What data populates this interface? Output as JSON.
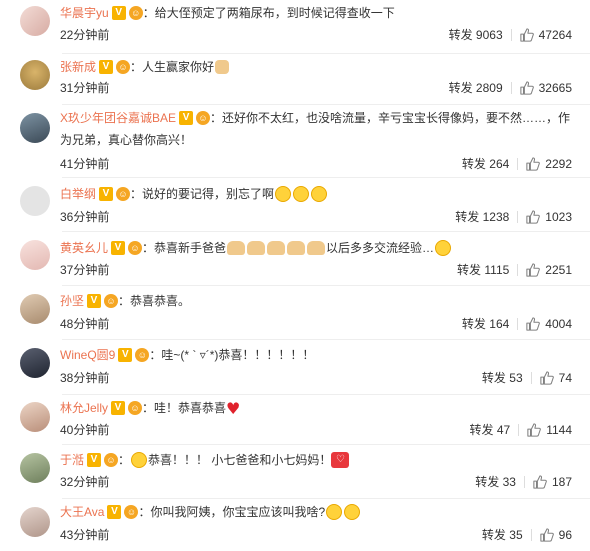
{
  "colors": {
    "username": "#eb7350",
    "text": "#333333",
    "badge_v": "#f8b300",
    "divider": "#eeeeee"
  },
  "labels": {
    "repost": "转发",
    "colon": "："
  },
  "comments": [
    {
      "username": "华晨宇yu",
      "avatar_color": "#e8c5bf",
      "text": "给大侄预定了两箱尿布，到时候记得查收一下",
      "emojis": [],
      "time": "22分钟前",
      "reposts": "9063",
      "likes": "47264"
    },
    {
      "username": "张新成",
      "avatar_color": "#c7a25c",
      "text": "人生赢家你好",
      "emojis": [
        "thumbs-up-emoji"
      ],
      "time": "31分钟前",
      "reposts": "2809",
      "likes": "32665"
    },
    {
      "username": "X玖少年团谷嘉诚BAE",
      "avatar_color": "#5f7586",
      "text": "还好你不太红，也没啥流量，辛亏宝宝长得像妈，要不然……，作为兄弟，真心替你高兴！",
      "emojis": [],
      "time": "41分钟前",
      "reposts": "264",
      "likes": "2292"
    },
    {
      "username": "白举纲",
      "avatar_color": "#dddddd",
      "text": "说好的要记得，别忘了啊",
      "emojis": [
        "smile-emoji",
        "smile-emoji",
        "smile-emoji"
      ],
      "time": "36分钟前",
      "reposts": "1238",
      "likes": "1023"
    },
    {
      "username": "黄英幺儿",
      "avatar_color": "#f2d5d2",
      "text": "恭喜新手爸爸",
      "text_after": "以后多多交流经验…",
      "emojis": [
        "clap-emoji",
        "clap-emoji",
        "clap-emoji",
        "clap-emoji",
        "clap-emoji"
      ],
      "time": "37分钟前",
      "reposts": "1115",
      "likes": "2251"
    },
    {
      "username": "孙坚",
      "avatar_color": "#c9b29b",
      "text": "恭喜恭喜。",
      "emojis": [],
      "time": "48分钟前",
      "reposts": "164",
      "likes": "4004"
    },
    {
      "username": "WineQ圆9",
      "avatar_color": "#3a3f4b",
      "text": "哇~(* ` ▿´*)恭喜！！！！！！",
      "emojis": [],
      "time": "38分钟前",
      "reposts": "53",
      "likes": "74"
    },
    {
      "username": "林允Jelly",
      "avatar_color": "#d9b9a8",
      "text": "哇！恭喜恭喜",
      "emojis": [
        "heart-emoji"
      ],
      "time": "40分钟前",
      "reposts": "47",
      "likes": "1144"
    },
    {
      "username": "于湉",
      "avatar_color": "#8a9a7b",
      "text": "恭喜！！！ 小七爸爸和小七妈妈！",
      "emojis": [
        "surprised-emoji",
        "stamp-emoji"
      ],
      "time": "32分钟前",
      "reposts": "33",
      "likes": "187"
    },
    {
      "username": "大王Ava",
      "avatar_color": "#c8b6ae",
      "text": "你叫我阿姨，你宝宝应该叫我啥?",
      "emojis": [
        "grin-emoji",
        "grin-emoji"
      ],
      "time": "43分钟前",
      "reposts": "35",
      "likes": "96"
    }
  ]
}
